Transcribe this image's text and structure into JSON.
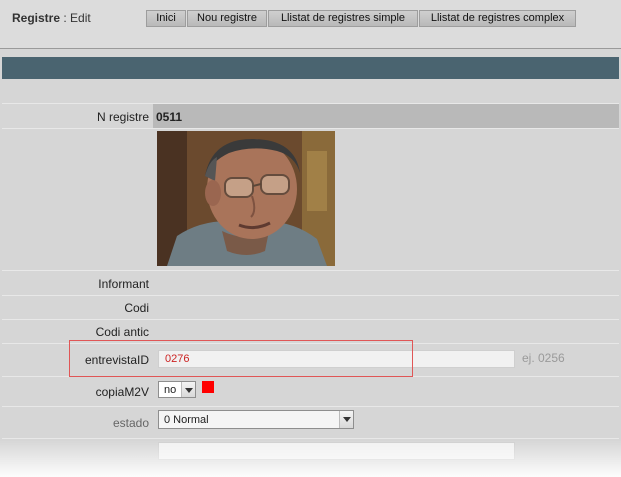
{
  "header": {
    "section": "Registre",
    "separator": " : ",
    "mode": "Edit",
    "nav": [
      "Inici",
      "Nou registre",
      "Llistat de registres simple",
      "Llistat de registres complex"
    ]
  },
  "fields": {
    "n_registre": {
      "label": "N registre",
      "value": "0511"
    },
    "informant": {
      "label": "Informant"
    },
    "codi": {
      "label": "Codi"
    },
    "codi_antic": {
      "label": "Codi antic"
    },
    "entrevista": {
      "label": "entrevistaID",
      "value": "0276",
      "hint": "ej. 0256"
    },
    "copia": {
      "label": "copiaM2V",
      "value": "no",
      "status_color": "#ff0000"
    },
    "estado": {
      "label": "estado",
      "value": "0 Normal"
    }
  },
  "colors": {
    "banner": "#4a6470",
    "highlight_border": "#e05656",
    "input_text": "#cc2222"
  },
  "image": {
    "subject": "portrait-photo"
  }
}
